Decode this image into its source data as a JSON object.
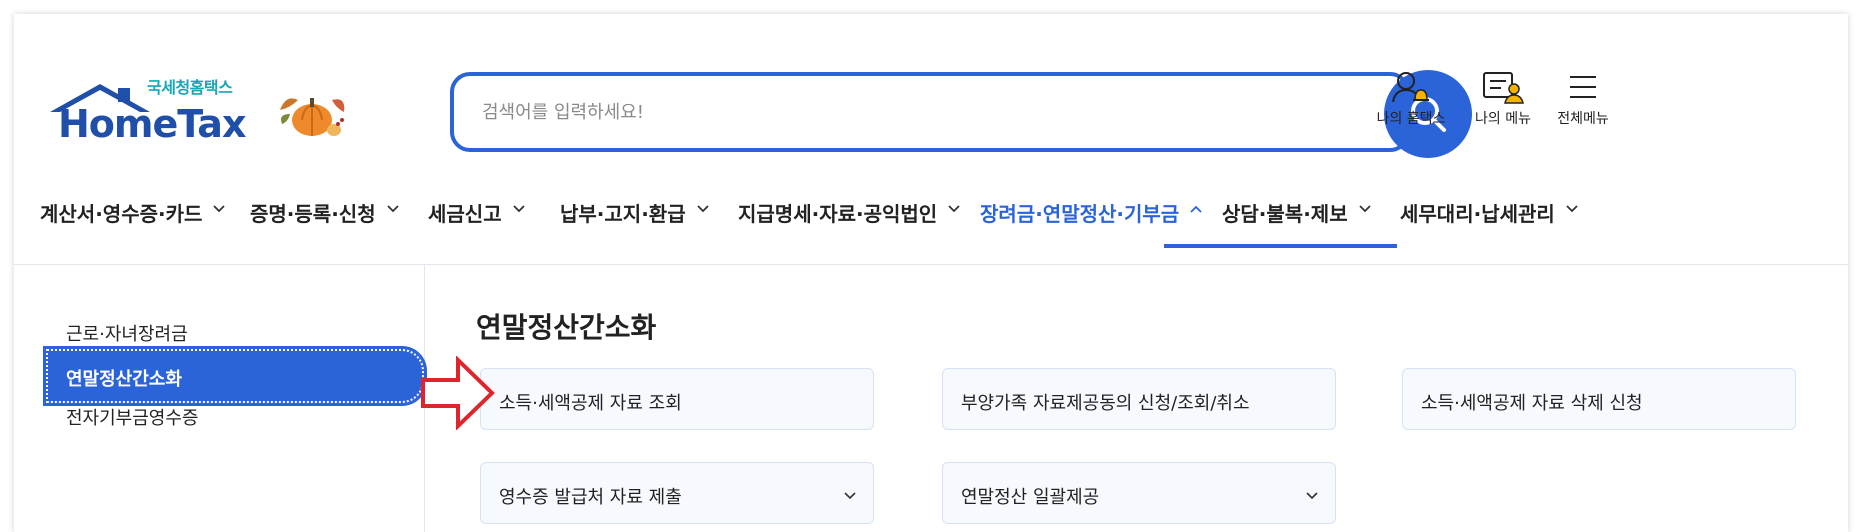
{
  "header": {
    "logo_kr": "국세청홈택스",
    "logo_en": "HomeTax",
    "search_placeholder": "검색어를 입력하세요!",
    "search_icon": "search-icon",
    "util": [
      {
        "label": "나의 홈택스",
        "icon": "user-bell-icon"
      },
      {
        "label": "나의 메뉴",
        "icon": "user-menu-icon"
      },
      {
        "label": "전체메뉴",
        "icon": "hamburger-icon"
      }
    ]
  },
  "gnb": {
    "items": [
      {
        "label": "계산서·영수증·카드"
      },
      {
        "label": "증명·등록·신청"
      },
      {
        "label": "세금신고"
      },
      {
        "label": "납부·고지·환급"
      },
      {
        "label": "지급명세·자료·공익법인"
      },
      {
        "label": "장려금·연말정산·기부금"
      },
      {
        "label": "상담·불복·제보"
      },
      {
        "label": "세무대리·납세관리"
      }
    ],
    "active_index": 5,
    "active_color": "#2b63d9"
  },
  "lnb": {
    "items": [
      {
        "label": "근로·자녀장려금"
      },
      {
        "label": "연말정산간소화"
      },
      {
        "label": "전자기부금영수증"
      }
    ],
    "active_index": 1
  },
  "content": {
    "title": "연말정산간소화",
    "cards": [
      {
        "label": "소득·세액공제 자료 조회",
        "has_dropdown": false
      },
      {
        "label": "부양가족 자료제공동의 신청/조회/취소",
        "has_dropdown": false
      },
      {
        "label": "소득·세액공제 자료 삭제 신청",
        "has_dropdown": false
      },
      {
        "label": "영수증 발급처 자료 제출",
        "has_dropdown": true
      },
      {
        "label": "연말정산 일괄제공",
        "has_dropdown": true
      }
    ],
    "highlight_arrow_color": "#e0242b"
  }
}
